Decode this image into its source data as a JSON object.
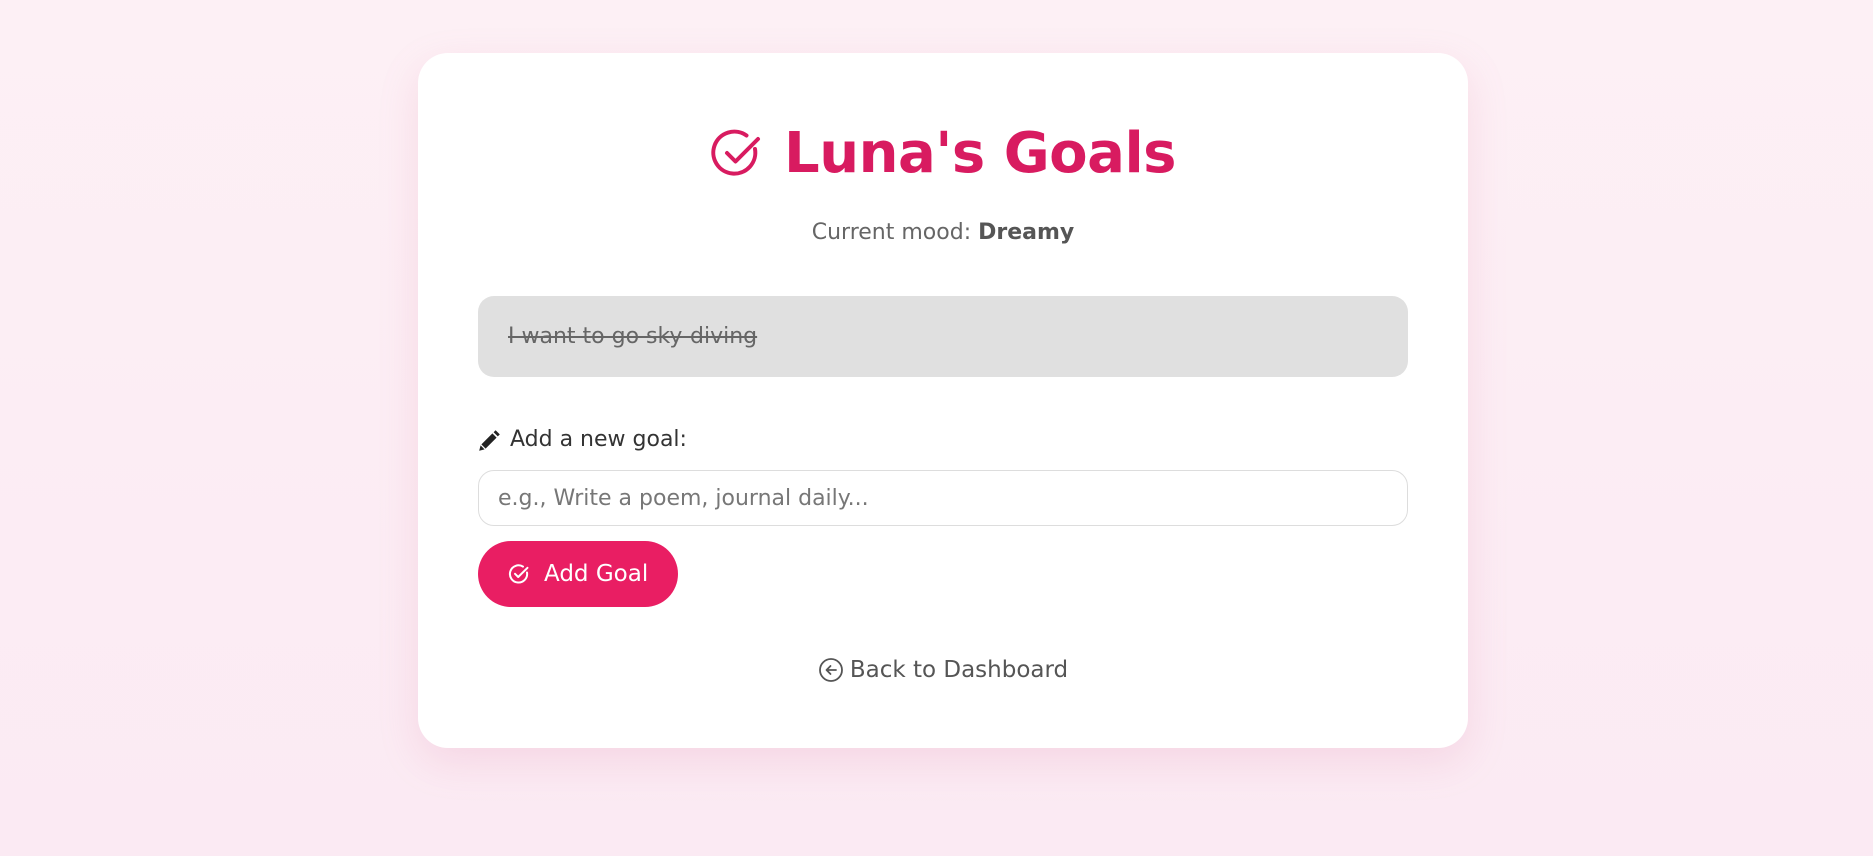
{
  "header": {
    "title": "Luna's Goals",
    "title_icon": "check-circle-icon",
    "accent_color": "#d81b60"
  },
  "mood": {
    "label": "Current mood: ",
    "value": "Dreamy"
  },
  "goals": [
    {
      "text": "I want to go sky-diving",
      "completed": true
    }
  ],
  "add_goal": {
    "label": "Add a new goal:",
    "label_icon": "pencil-icon",
    "input_value": "",
    "input_placeholder": "e.g., Write a poem, journal daily...",
    "button_label": "Add Goal",
    "button_icon": "check-circle-icon",
    "button_color": "#e91e63"
  },
  "footer": {
    "back_label": "Back to Dashboard",
    "back_icon": "arrow-left-circle-icon"
  }
}
